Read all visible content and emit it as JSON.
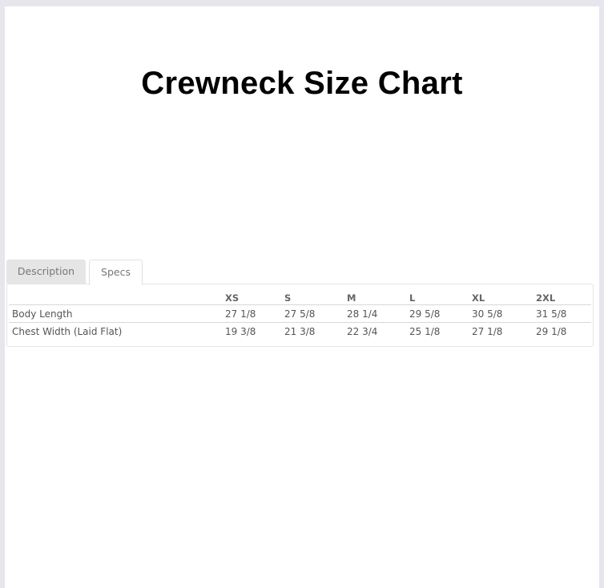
{
  "title": "Crewneck Size Chart",
  "tabs": [
    {
      "label": "Description",
      "active": false
    },
    {
      "label": "Specs",
      "active": true
    }
  ],
  "specs_table": {
    "headers": [
      "",
      "XS",
      "S",
      "M",
      "L",
      "XL",
      "2XL"
    ],
    "rows": [
      {
        "label": "Body Length",
        "values": [
          "27 1/8",
          "27 5/8",
          "28 1/4",
          "29 5/8",
          "30 5/8",
          "31 5/8"
        ]
      },
      {
        "label": "Chest Width (Laid Flat)",
        "values": [
          "19 3/8",
          "21 3/8",
          "22 3/4",
          "25 1/8",
          "27 1/8",
          "29 1/8"
        ]
      }
    ]
  }
}
